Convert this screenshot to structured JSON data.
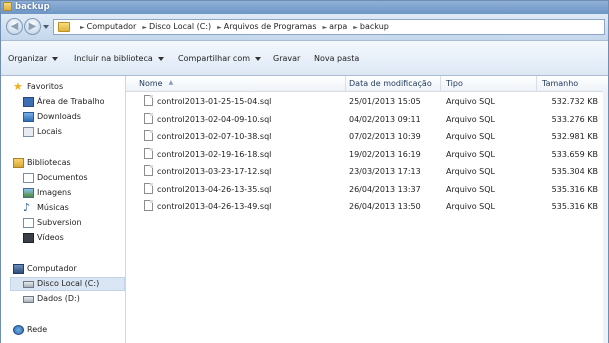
{
  "window": {
    "title": "backup"
  },
  "address": {
    "crumbs": [
      "Computador",
      "Disco Local (C:)",
      "Arquivos de Programas",
      "arpa",
      "backup"
    ]
  },
  "toolbar": {
    "organize": "Organizar",
    "include_library": "Incluir na biblioteca",
    "share": "Compartilhar com",
    "burn": "Gravar",
    "new_folder": "Nova pasta"
  },
  "sidebar": {
    "favorites": {
      "label": "Favoritos",
      "items": [
        "Área de Trabalho",
        "Downloads",
        "Locais"
      ]
    },
    "libraries": {
      "label": "Bibliotecas",
      "items": [
        "Documentos",
        "Imagens",
        "Músicas",
        "Subversion",
        "Vídeos"
      ]
    },
    "computer": {
      "label": "Computador",
      "items": [
        "Disco Local (C:)",
        "Dados (D:)"
      ]
    },
    "network": {
      "label": "Rede"
    }
  },
  "columns": {
    "name": "Nome",
    "modified": "Data de modificação",
    "type": "Tipo",
    "size": "Tamanho"
  },
  "files": [
    {
      "name": "control2013-01-25-15-04.sql",
      "modified": "25/01/2013 15:05",
      "type": "Arquivo SQL",
      "size": "532.732 KB"
    },
    {
      "name": "control2013-02-04-09-10.sql",
      "modified": "04/02/2013 09:11",
      "type": "Arquivo SQL",
      "size": "533.276 KB"
    },
    {
      "name": "control2013-02-07-10-38.sql",
      "modified": "07/02/2013 10:39",
      "type": "Arquivo SQL",
      "size": "532.981 KB"
    },
    {
      "name": "control2013-02-19-16-18.sql",
      "modified": "19/02/2013 16:19",
      "type": "Arquivo SQL",
      "size": "533.659 KB"
    },
    {
      "name": "control2013-03-23-17-12.sql",
      "modified": "23/03/2013 17:13",
      "type": "Arquivo SQL",
      "size": "535.304 KB"
    },
    {
      "name": "control2013-04-26-13-35.sql",
      "modified": "26/04/2013 13:37",
      "type": "Arquivo SQL",
      "size": "535.316 KB"
    },
    {
      "name": "control2013-04-26-13-49.sql",
      "modified": "26/04/2013 13:50",
      "type": "Arquivo SQL",
      "size": "535.316 KB"
    }
  ]
}
